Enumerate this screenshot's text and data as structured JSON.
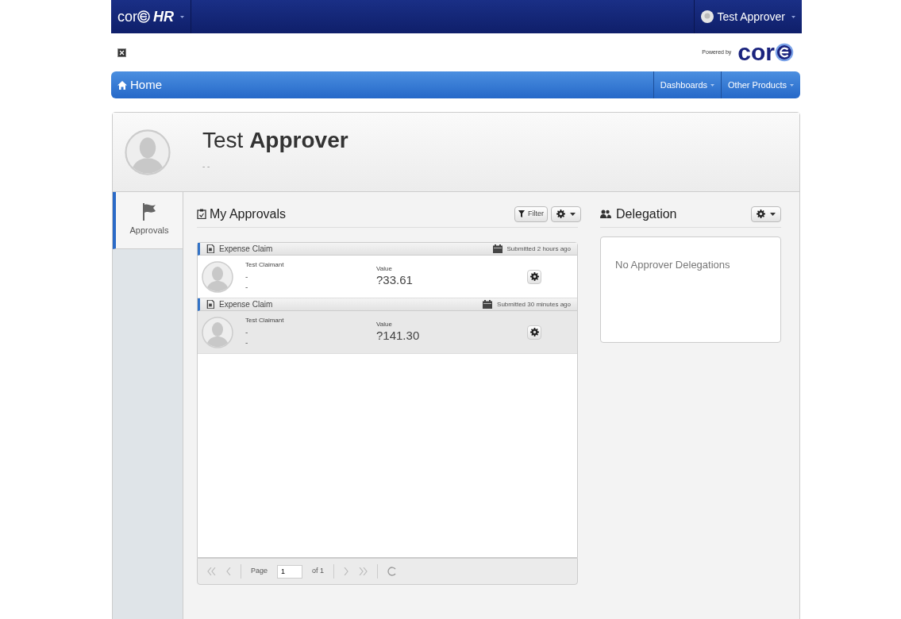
{
  "topbar": {
    "brand": "cor",
    "brand_suffix": "HR",
    "user": "Test Approver"
  },
  "powered": {
    "label": "Powered by",
    "logo": "cor"
  },
  "nav": {
    "home": "Home",
    "menus": [
      "Dashboards",
      "Other Products"
    ]
  },
  "profile": {
    "name": "Test **Approver**",
    "subtitle": "- -"
  },
  "sidebar": {
    "tabs": [
      {
        "label": "Approvals",
        "selected": true
      }
    ]
  },
  "approvals": {
    "title": "My Approvals",
    "filter": "Filter",
    "items": [
      {
        "type": "Expense Claim",
        "submitted": "Submitted 2 hours ago",
        "claimant": "Test Claimant",
        "line_1": "-",
        "line_2": "-",
        "value_label": "Value",
        "value": "?33.61",
        "selected": false
      },
      {
        "type": "Expense Claim",
        "submitted": "Submitted 30 minutes ago",
        "claimant": "Test Claimant",
        "line_1": "-",
        "line_2": "-",
        "value_label": "Value",
        "value": "?141.30",
        "selected": true
      }
    ],
    "pager": {
      "page_label": "Page",
      "page": "1",
      "of": "of 1"
    }
  },
  "delegation": {
    "title": "Delegation",
    "empty": "No Approver Delegations"
  }
}
